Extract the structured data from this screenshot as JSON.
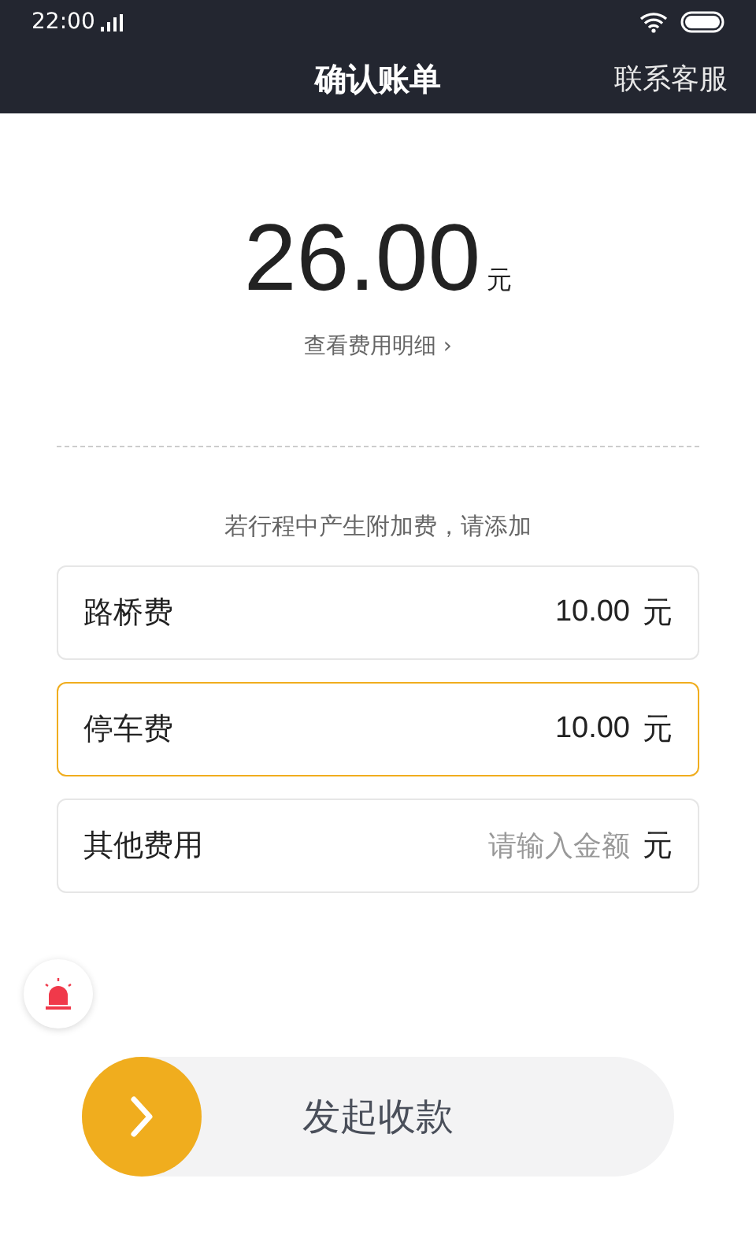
{
  "status_bar": {
    "time": "22:00"
  },
  "nav": {
    "title": "确认账单",
    "action": "联系客服"
  },
  "amount": {
    "value": "26.00",
    "unit": "元",
    "detail_link": "查看费用明细",
    "detail_arrow": "›"
  },
  "hint": "若行程中产生附加费，请添加",
  "fees": [
    {
      "label": "路桥费",
      "value": "10.00",
      "unit": "元",
      "selected": false
    },
    {
      "label": "停车费",
      "value": "10.00",
      "unit": "元",
      "selected": true
    },
    {
      "label": "其他费用",
      "placeholder": "请输入金额",
      "unit": "元",
      "selected": false
    }
  ],
  "slide_button": {
    "label": "发起收款",
    "level": 0
  }
}
